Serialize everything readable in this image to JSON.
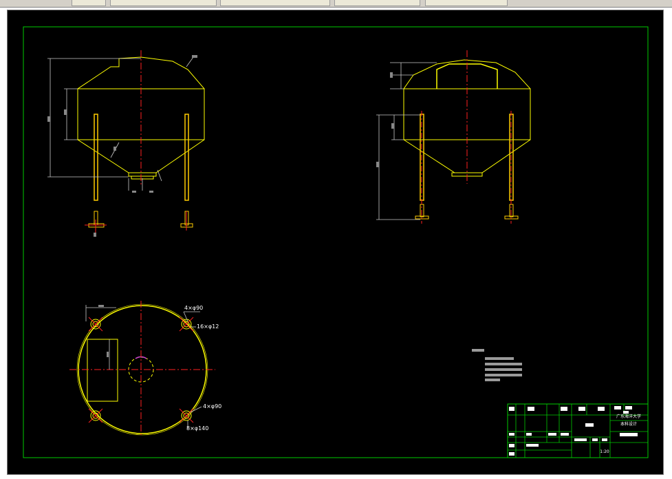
{
  "toolbar": {
    "tabs": [
      "",
      "",
      "",
      "",
      ""
    ]
  },
  "drawing": {
    "annotations": {
      "top_left_holes": "4×φ90",
      "bolt_holes": "16×φ12",
      "bottom_right_holes": "4×φ90",
      "bottom_right_bolt": "8×φ140"
    },
    "title_block": {
      "school_line1": "广东海洋大学",
      "school_line2": "本科设计",
      "drawing_name": "储液罐",
      "scale": "1:20",
      "doc_name": "装配图",
      "header_cells": [
        "标记",
        "处数",
        "分区",
        "更改文件号",
        "签名",
        "年月日"
      ],
      "role_cells": [
        "设计",
        "标准化",
        "审核",
        "工艺",
        "批准"
      ],
      "stage_labels": [
        "阶段标记",
        "重量",
        "比例"
      ]
    }
  },
  "colors": {
    "frame": "#00cc00",
    "outline": "#ffff00",
    "centerline": "#ff2020",
    "leg": "#ffcc00",
    "text": "#ffffff",
    "dim": "#c8c8c8"
  }
}
